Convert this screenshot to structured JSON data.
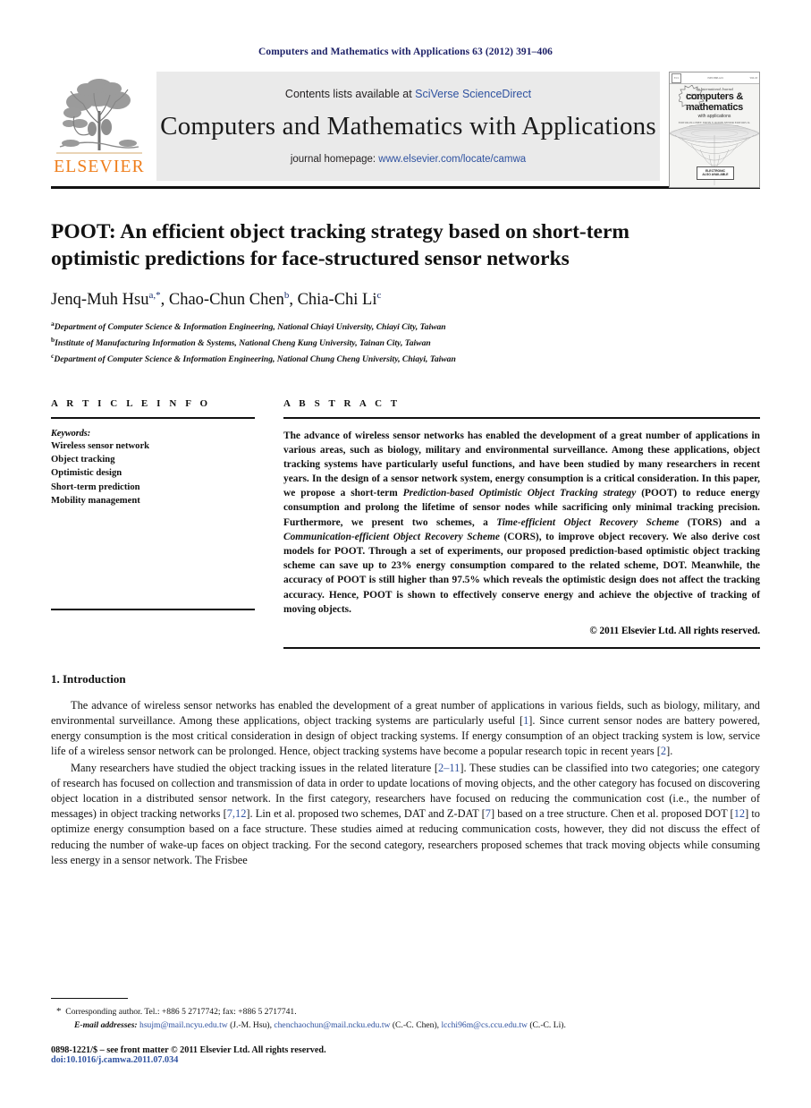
{
  "running_head": "Computers and Mathematics with Applications 63 (2012) 391–406",
  "masthead": {
    "publisher_name": "ELSEVIER",
    "contents_prefix": "Contents lists available at ",
    "contents_link": "SciVerse ScienceDirect",
    "journal_title": "Computers and Mathematics with Applications",
    "homepage_prefix": "journal homepage: ",
    "homepage_link": "www.elsevier.com/locate/camwa",
    "cover": {
      "overline": "An International Journal",
      "title_line1": "computers &",
      "title_line2": "mathematics",
      "subtitle": "with applications",
      "editors": "EDITOR-IN-CHIEF: ERVIN Y. RODIN\nSENIOR EDITORS: R. GLOWINSKI  H.-K. CHENG  H.W. CHENG",
      "badge_text": "Available online at ScienceDirect",
      "electronic_label": "ELECTRONIC\nALSO AVAILABLE"
    }
  },
  "article": {
    "title": "POOT: An efficient object tracking strategy based on short-term optimistic predictions for face-structured sensor networks",
    "authors": [
      {
        "name": "Jenq-Muh Hsu",
        "marks": "a,*"
      },
      {
        "name": "Chao-Chun Chen",
        "marks": "b"
      },
      {
        "name": "Chia-Chi Li",
        "marks": "c"
      }
    ],
    "affiliations": [
      {
        "mark": "a",
        "text": "Department of Computer Science & Information Engineering, National Chiayi University, Chiayi City, Taiwan"
      },
      {
        "mark": "b",
        "text": "Institute of Manufacturing Information & Systems, National Cheng Kung University, Tainan City, Taiwan"
      },
      {
        "mark": "c",
        "text": "Department of Computer Science & Information Engineering, National Chung Cheng University, Chiayi, Taiwan"
      }
    ]
  },
  "article_info": {
    "heading": "A R T I C L E   I N F O",
    "keywords_label": "Keywords:",
    "keywords": [
      "Wireless sensor network",
      "Object tracking",
      "Optimistic design",
      "Short-term prediction",
      "Mobility management"
    ]
  },
  "abstract": {
    "heading": "A B S T R A C T",
    "part1": "The advance of wireless sensor networks has enabled the development of a great number of applications in various areas, such as biology, military and environmental surveillance. Among these applications, object tracking systems have particularly useful functions, and have been studied by many researchers in recent years. In the design of a sensor network system, energy consumption is a critical consideration. In this paper, we propose a short-term ",
    "italic1": "Prediction-based Optimistic Object Tracking strategy",
    "part2": " (POOT) to reduce energy consumption and prolong the lifetime of sensor nodes while sacrificing only minimal tracking precision. Furthermore, we present two schemes, a ",
    "italic2": "Time-efficient Object Recovery Scheme",
    "part3": " (TORS) and a ",
    "italic3": "Communication-efficient Object Recovery Scheme",
    "part4": " (CORS), to improve object recovery. We also derive cost models for POOT. Through a set of experiments, our proposed prediction-based optimistic object tracking scheme can save up to 23% energy consumption compared to the related scheme, DOT. Meanwhile, the accuracy of POOT is still higher than 97.5% which reveals the optimistic design does not affect the tracking accuracy. Hence, POOT is shown to effectively conserve energy and achieve the objective of tracking of moving objects.",
    "copyright": "© 2011 Elsevier Ltd. All rights reserved."
  },
  "body": {
    "section_title": "1. Introduction",
    "paragraph1_a": "The advance of wireless sensor networks has enabled the development of a great number of applications in various fields, such as biology, military, and environmental surveillance. Among these applications, object tracking systems are particularly useful [",
    "p1_ref1": "1",
    "paragraph1_b": "]. Since current sensor nodes are battery powered, energy consumption is the most critical consideration in design of object tracking systems. If energy consumption of an object tracking system is low, service life of a wireless sensor network can be prolonged. Hence, object tracking systems have become a popular research topic in recent years [",
    "p1_ref2": "2",
    "paragraph1_c": "].",
    "paragraph2_a": "Many researchers have studied the object tracking issues in the related literature [",
    "p2_ref1": "2–11",
    "paragraph2_b": "]. These studies can be classified into two categories; one category of research has focused on collection and transmission of data in order to update locations of moving objects, and the other category has focused on discovering object location in a distributed sensor network. In the first category, researchers have focused on reducing the communication cost (i.e., the number of messages) in object tracking networks [",
    "p2_ref2": "7,12",
    "paragraph2_c": "]. Lin et al. proposed two schemes, DAT and Z-DAT [",
    "p2_ref3": "7",
    "paragraph2_d": "] based on a tree structure. Chen et al. proposed DOT [",
    "p2_ref4": "12",
    "paragraph2_e": "] to optimize energy consumption based on a face structure. These studies aimed at reducing communication costs, however, they did not discuss the effect of reducing the number of wake-up faces on object tracking. For the second category, researchers proposed schemes that track moving objects while consuming less energy in a sensor network. The Frisbee"
  },
  "footnotes": {
    "corresponding": "Corresponding author. Tel.: +886 5 2717742; fax: +886 5 2717741.",
    "email_label": "E-mail addresses:",
    "emails": [
      {
        "address": "hsujm@mail.ncyu.edu.tw",
        "attrib": " (J.-M. Hsu), "
      },
      {
        "address": "chenchaochun@mail.ncku.edu.tw",
        "attrib": " (C.-C. Chen), "
      },
      {
        "address": "lcchi96m@cs.ccu.edu.tw",
        "attrib": " (C.-C. Li)."
      }
    ],
    "issn": "0898-1221/$ – see front matter © 2011 Elsevier Ltd. All rights reserved.",
    "doi": "doi:10.1016/j.camwa.2011.07.034"
  },
  "colors": {
    "link": "#2f52a0",
    "running_head": "#1b1f66",
    "elsevier_orange": "#ef7d1a",
    "band_gray": "#eaeaea"
  }
}
